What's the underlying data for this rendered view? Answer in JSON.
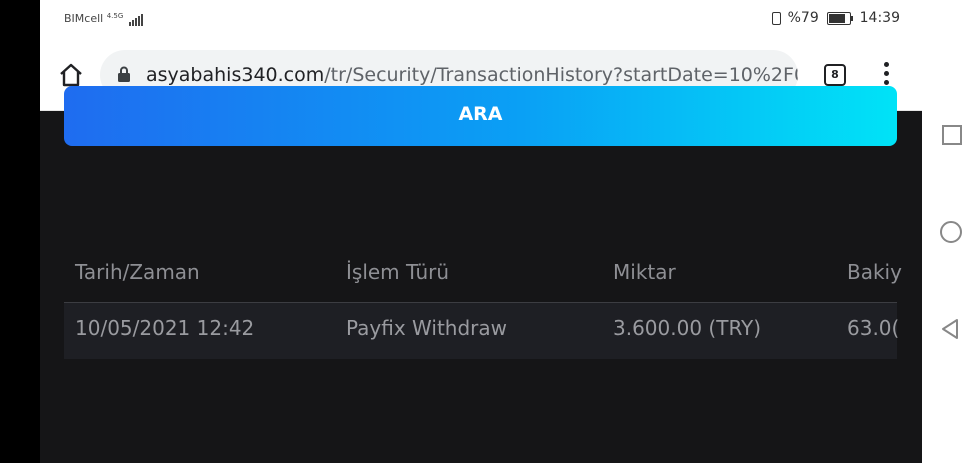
{
  "status_bar": {
    "carrier": "BIMcell",
    "network": "4.5G",
    "battery_pct": "%79",
    "time": "14:39"
  },
  "browser": {
    "url_domain": "asyabahis340.com",
    "url_path": "/tr/Security/TransactionHistory?startDate=10%2F0",
    "tab_count": "8",
    "icons": {
      "home": "home-icon",
      "lock": "lock-icon",
      "menu": "more-vert-icon"
    }
  },
  "page": {
    "search_button_label": "ARA",
    "table": {
      "headers": [
        "Tarih/Zaman",
        "İşlem Türü",
        "Miktar",
        "Bakiy"
      ],
      "rows": [
        [
          "10/05/2021 12:42",
          "Payfix Withdraw",
          "3.600.00 (TRY)",
          "63.0("
        ]
      ]
    }
  },
  "colors": {
    "background": "#151517",
    "button_gradient_start": "#1f6cf0",
    "button_gradient_end": "#00e3f7",
    "row_bg": "#1e1f24"
  }
}
